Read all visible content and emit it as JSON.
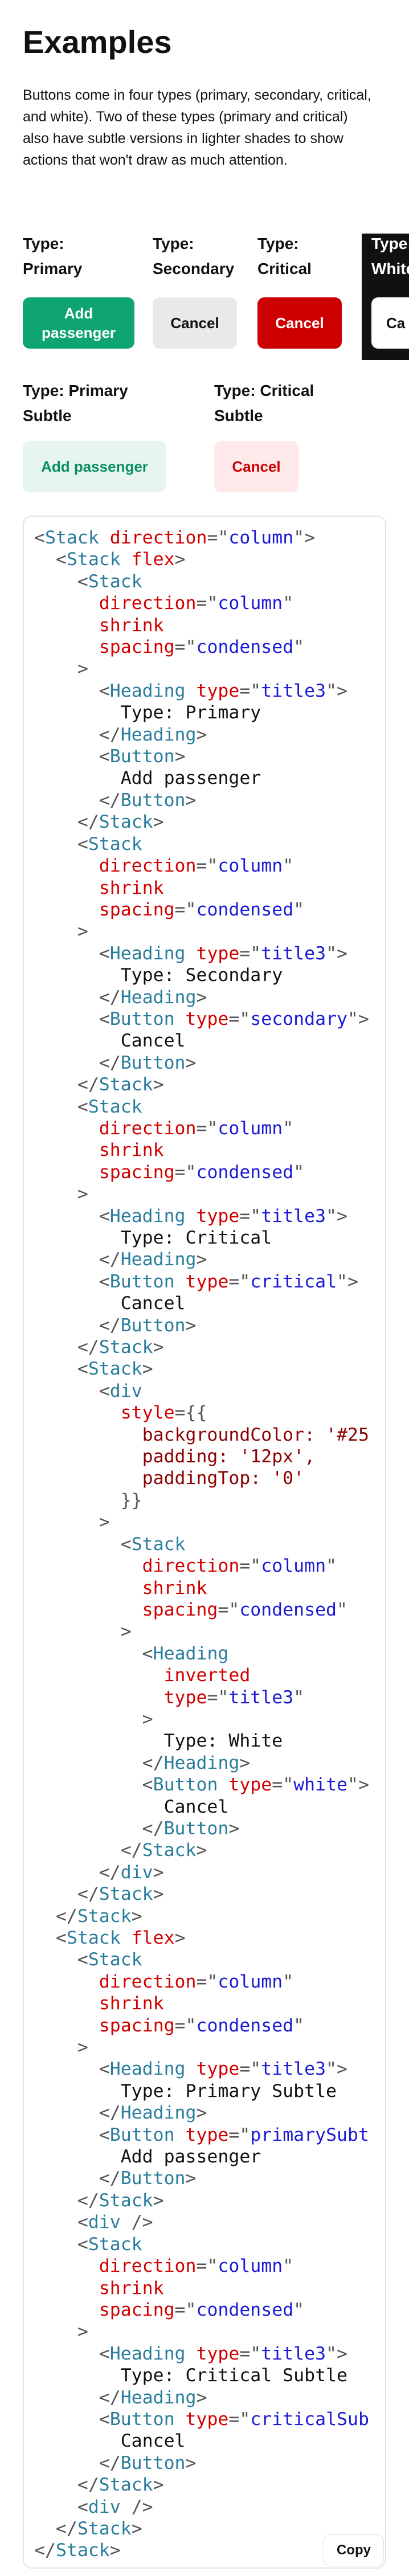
{
  "page": {
    "title": "Examples",
    "intro": "Buttons come in four types (primary, secondary, critical, and white). Two of these types (primary and critical) also have subtle versions in lighter shades to show actions that won't draw as much attention."
  },
  "examples": [
    {
      "heading": "Type:\nPrimary",
      "button_label": "Add\npassenger",
      "button_type": "primary"
    },
    {
      "heading": "Type:\nSecondary",
      "button_label": "Cancel",
      "button_type": "secondary"
    },
    {
      "heading": "Type:\nCritical",
      "button_label": "Cancel",
      "button_type": "critical"
    },
    {
      "heading": "Type:\nWhite",
      "button_label": "Ca",
      "button_type": "white",
      "inverted": true
    }
  ],
  "subtle_examples": [
    {
      "heading": "Type: Primary\nSubtle",
      "button_label": "Add passenger",
      "button_type": "primarySubtle"
    },
    {
      "heading": "Type: Critical\nSubtle",
      "button_label": "Cancel",
      "button_type": "criticalSubtle"
    }
  ],
  "code_lines": [
    [
      [
        "punc",
        "<"
      ],
      [
        "tag",
        "Stack "
      ],
      [
        "attr",
        "direction"
      ],
      [
        "punc",
        "=\""
      ],
      [
        "str",
        "column"
      ],
      [
        "punc",
        "\">"
      ]
    ],
    [
      [
        "punc",
        "  <"
      ],
      [
        "tag",
        "Stack "
      ],
      [
        "attr",
        "flex"
      ],
      [
        "punc",
        ">"
      ]
    ],
    [
      [
        "punc",
        "    <"
      ],
      [
        "tag",
        "Stack"
      ]
    ],
    [
      [
        "attr",
        "      direction"
      ],
      [
        "punc",
        "=\""
      ],
      [
        "str",
        "column"
      ],
      [
        "punc",
        "\""
      ]
    ],
    [
      [
        "attr",
        "      shrink"
      ]
    ],
    [
      [
        "attr",
        "      spacing"
      ],
      [
        "punc",
        "=\""
      ],
      [
        "str",
        "condensed"
      ],
      [
        "punc",
        "\""
      ]
    ],
    [
      [
        "punc",
        "    >"
      ]
    ],
    [
      [
        "punc",
        "      <"
      ],
      [
        "tag",
        "Heading "
      ],
      [
        "attr",
        "type"
      ],
      [
        "punc",
        "=\""
      ],
      [
        "str",
        "title3"
      ],
      [
        "punc",
        "\">"
      ]
    ],
    [
      [
        "txt",
        "        Type: Primary"
      ]
    ],
    [
      [
        "punc",
        "      </"
      ],
      [
        "tag",
        "Heading"
      ],
      [
        "punc",
        ">"
      ]
    ],
    [
      [
        "punc",
        "      <"
      ],
      [
        "tag",
        "Button"
      ],
      [
        "punc",
        ">"
      ]
    ],
    [
      [
        "txt",
        "        Add passenger"
      ]
    ],
    [
      [
        "punc",
        "      </"
      ],
      [
        "tag",
        "Button"
      ],
      [
        "punc",
        ">"
      ]
    ],
    [
      [
        "punc",
        "    </"
      ],
      [
        "tag",
        "Stack"
      ],
      [
        "punc",
        ">"
      ]
    ],
    [
      [
        "punc",
        "    <"
      ],
      [
        "tag",
        "Stack"
      ]
    ],
    [
      [
        "attr",
        "      direction"
      ],
      [
        "punc",
        "=\""
      ],
      [
        "str",
        "column"
      ],
      [
        "punc",
        "\""
      ]
    ],
    [
      [
        "attr",
        "      shrink"
      ]
    ],
    [
      [
        "attr",
        "      spacing"
      ],
      [
        "punc",
        "=\""
      ],
      [
        "str",
        "condensed"
      ],
      [
        "punc",
        "\""
      ]
    ],
    [
      [
        "punc",
        "    >"
      ]
    ],
    [
      [
        "punc",
        "      <"
      ],
      [
        "tag",
        "Heading "
      ],
      [
        "attr",
        "type"
      ],
      [
        "punc",
        "=\""
      ],
      [
        "str",
        "title3"
      ],
      [
        "punc",
        "\">"
      ]
    ],
    [
      [
        "txt",
        "        Type: Secondary"
      ]
    ],
    [
      [
        "punc",
        "      </"
      ],
      [
        "tag",
        "Heading"
      ],
      [
        "punc",
        ">"
      ]
    ],
    [
      [
        "punc",
        "      <"
      ],
      [
        "tag",
        "Button "
      ],
      [
        "attr",
        "type"
      ],
      [
        "punc",
        "=\""
      ],
      [
        "str",
        "secondary"
      ],
      [
        "punc",
        "\">"
      ]
    ],
    [
      [
        "txt",
        "        Cancel"
      ]
    ],
    [
      [
        "punc",
        "      </"
      ],
      [
        "tag",
        "Button"
      ],
      [
        "punc",
        ">"
      ]
    ],
    [
      [
        "punc",
        "    </"
      ],
      [
        "tag",
        "Stack"
      ],
      [
        "punc",
        ">"
      ]
    ],
    [
      [
        "punc",
        "    <"
      ],
      [
        "tag",
        "Stack"
      ]
    ],
    [
      [
        "attr",
        "      direction"
      ],
      [
        "punc",
        "=\""
      ],
      [
        "str",
        "column"
      ],
      [
        "punc",
        "\""
      ]
    ],
    [
      [
        "attr",
        "      shrink"
      ]
    ],
    [
      [
        "attr",
        "      spacing"
      ],
      [
        "punc",
        "=\""
      ],
      [
        "str",
        "condensed"
      ],
      [
        "punc",
        "\""
      ]
    ],
    [
      [
        "punc",
        "    >"
      ]
    ],
    [
      [
        "punc",
        "      <"
      ],
      [
        "tag",
        "Heading "
      ],
      [
        "attr",
        "type"
      ],
      [
        "punc",
        "=\""
      ],
      [
        "str",
        "title3"
      ],
      [
        "punc",
        "\">"
      ]
    ],
    [
      [
        "txt",
        "        Type: Critical"
      ]
    ],
    [
      [
        "punc",
        "      </"
      ],
      [
        "tag",
        "Heading"
      ],
      [
        "punc",
        ">"
      ]
    ],
    [
      [
        "punc",
        "      <"
      ],
      [
        "tag",
        "Button "
      ],
      [
        "attr",
        "type"
      ],
      [
        "punc",
        "=\""
      ],
      [
        "str",
        "critical"
      ],
      [
        "punc",
        "\">"
      ]
    ],
    [
      [
        "txt",
        "        Cancel"
      ]
    ],
    [
      [
        "punc",
        "      </"
      ],
      [
        "tag",
        "Button"
      ],
      [
        "punc",
        ">"
      ]
    ],
    [
      [
        "punc",
        "    </"
      ],
      [
        "tag",
        "Stack"
      ],
      [
        "punc",
        ">"
      ]
    ],
    [
      [
        "punc",
        "    <"
      ],
      [
        "tag",
        "Stack"
      ],
      [
        "punc",
        ">"
      ]
    ],
    [
      [
        "punc",
        "      <"
      ],
      [
        "tag",
        "div"
      ]
    ],
    [
      [
        "attr",
        "        style"
      ],
      [
        "punc",
        "={{"
      ]
    ],
    [
      [
        "expr",
        "          backgroundColor: '#25"
      ]
    ],
    [
      [
        "expr",
        "          padding: '12px',"
      ]
    ],
    [
      [
        "expr",
        "          paddingTop: '0'"
      ]
    ],
    [
      [
        "punc",
        "        }}"
      ]
    ],
    [
      [
        "punc",
        "      >"
      ]
    ],
    [
      [
        "punc",
        "        <"
      ],
      [
        "tag",
        "Stack"
      ]
    ],
    [
      [
        "attr",
        "          direction"
      ],
      [
        "punc",
        "=\""
      ],
      [
        "str",
        "column"
      ],
      [
        "punc",
        "\""
      ]
    ],
    [
      [
        "attr",
        "          shrink"
      ]
    ],
    [
      [
        "attr",
        "          spacing"
      ],
      [
        "punc",
        "=\""
      ],
      [
        "str",
        "condensed"
      ],
      [
        "punc",
        "\""
      ]
    ],
    [
      [
        "punc",
        "        >"
      ]
    ],
    [
      [
        "punc",
        "          <"
      ],
      [
        "tag",
        "Heading"
      ]
    ],
    [
      [
        "attr",
        "            inverted"
      ]
    ],
    [
      [
        "attr",
        "            type"
      ],
      [
        "punc",
        "=\""
      ],
      [
        "str",
        "title3"
      ],
      [
        "punc",
        "\""
      ]
    ],
    [
      [
        "punc",
        "          >"
      ]
    ],
    [
      [
        "txt",
        "            Type: White"
      ]
    ],
    [
      [
        "punc",
        "          </"
      ],
      [
        "tag",
        "Heading"
      ],
      [
        "punc",
        ">"
      ]
    ],
    [
      [
        "punc",
        "          <"
      ],
      [
        "tag",
        "Button "
      ],
      [
        "attr",
        "type"
      ],
      [
        "punc",
        "=\""
      ],
      [
        "str",
        "white"
      ],
      [
        "punc",
        "\">"
      ]
    ],
    [
      [
        "txt",
        "            Cancel"
      ]
    ],
    [
      [
        "punc",
        "          </"
      ],
      [
        "tag",
        "Button"
      ],
      [
        "punc",
        ">"
      ]
    ],
    [
      [
        "punc",
        "        </"
      ],
      [
        "tag",
        "Stack"
      ],
      [
        "punc",
        ">"
      ]
    ],
    [
      [
        "punc",
        "      </"
      ],
      [
        "tag",
        "div"
      ],
      [
        "punc",
        ">"
      ]
    ],
    [
      [
        "punc",
        "    </"
      ],
      [
        "tag",
        "Stack"
      ],
      [
        "punc",
        ">"
      ]
    ],
    [
      [
        "punc",
        "  </"
      ],
      [
        "tag",
        "Stack"
      ],
      [
        "punc",
        ">"
      ]
    ],
    [
      [
        "punc",
        "  <"
      ],
      [
        "tag",
        "Stack "
      ],
      [
        "attr",
        "flex"
      ],
      [
        "punc",
        ">"
      ]
    ],
    [
      [
        "punc",
        "    <"
      ],
      [
        "tag",
        "Stack"
      ]
    ],
    [
      [
        "attr",
        "      direction"
      ],
      [
        "punc",
        "=\""
      ],
      [
        "str",
        "column"
      ],
      [
        "punc",
        "\""
      ]
    ],
    [
      [
        "attr",
        "      shrink"
      ]
    ],
    [
      [
        "attr",
        "      spacing"
      ],
      [
        "punc",
        "=\""
      ],
      [
        "str",
        "condensed"
      ],
      [
        "punc",
        "\""
      ]
    ],
    [
      [
        "punc",
        "    >"
      ]
    ],
    [
      [
        "punc",
        "      <"
      ],
      [
        "tag",
        "Heading "
      ],
      [
        "attr",
        "type"
      ],
      [
        "punc",
        "=\""
      ],
      [
        "str",
        "title3"
      ],
      [
        "punc",
        "\">"
      ]
    ],
    [
      [
        "txt",
        "        Type: Primary Subtle"
      ]
    ],
    [
      [
        "punc",
        "      </"
      ],
      [
        "tag",
        "Heading"
      ],
      [
        "punc",
        ">"
      ]
    ],
    [
      [
        "punc",
        "      <"
      ],
      [
        "tag",
        "Button "
      ],
      [
        "attr",
        "type"
      ],
      [
        "punc",
        "=\""
      ],
      [
        "str",
        "primarySubt"
      ]
    ],
    [
      [
        "txt",
        "        Add passenger"
      ]
    ],
    [
      [
        "punc",
        "      </"
      ],
      [
        "tag",
        "Button"
      ],
      [
        "punc",
        ">"
      ]
    ],
    [
      [
        "punc",
        "    </"
      ],
      [
        "tag",
        "Stack"
      ],
      [
        "punc",
        ">"
      ]
    ],
    [
      [
        "punc",
        "    <"
      ],
      [
        "tag",
        "div "
      ],
      [
        "punc",
        "/>"
      ]
    ],
    [
      [
        "punc",
        "    <"
      ],
      [
        "tag",
        "Stack"
      ]
    ],
    [
      [
        "attr",
        "      direction"
      ],
      [
        "punc",
        "=\""
      ],
      [
        "str",
        "column"
      ],
      [
        "punc",
        "\""
      ]
    ],
    [
      [
        "attr",
        "      shrink"
      ]
    ],
    [
      [
        "attr",
        "      spacing"
      ],
      [
        "punc",
        "=\""
      ],
      [
        "str",
        "condensed"
      ],
      [
        "punc",
        "\""
      ]
    ],
    [
      [
        "punc",
        "    >"
      ]
    ],
    [
      [
        "punc",
        "      <"
      ],
      [
        "tag",
        "Heading "
      ],
      [
        "attr",
        "type"
      ],
      [
        "punc",
        "=\""
      ],
      [
        "str",
        "title3"
      ],
      [
        "punc",
        "\">"
      ]
    ],
    [
      [
        "txt",
        "        Type: Critical Subtle"
      ]
    ],
    [
      [
        "punc",
        "      </"
      ],
      [
        "tag",
        "Heading"
      ],
      [
        "punc",
        ">"
      ]
    ],
    [
      [
        "punc",
        "      <"
      ],
      [
        "tag",
        "Button "
      ],
      [
        "attr",
        "type"
      ],
      [
        "punc",
        "=\""
      ],
      [
        "str",
        "criticalSub"
      ]
    ],
    [
      [
        "txt",
        "        Cancel"
      ]
    ],
    [
      [
        "punc",
        "      </"
      ],
      [
        "tag",
        "Button"
      ],
      [
        "punc",
        ">"
      ]
    ],
    [
      [
        "punc",
        "    </"
      ],
      [
        "tag",
        "Stack"
      ],
      [
        "punc",
        ">"
      ]
    ],
    [
      [
        "punc",
        "    <"
      ],
      [
        "tag",
        "div "
      ],
      [
        "punc",
        "/>"
      ]
    ],
    [
      [
        "punc",
        "  </"
      ],
      [
        "tag",
        "Stack"
      ],
      [
        "punc",
        ">"
      ]
    ],
    [
      [
        "punc",
        "</"
      ],
      [
        "tag",
        "Stack"
      ],
      [
        "punc",
        ">"
      ]
    ]
  ],
  "copy_label": "Copy",
  "colors": {
    "primary": "#0fa573",
    "secondary": "#e9e9e9",
    "critical": "#cc0000",
    "white_panel": "#111111",
    "primary_subtle": "#e6f5f0",
    "critical_subtle": "#fde9e9"
  }
}
